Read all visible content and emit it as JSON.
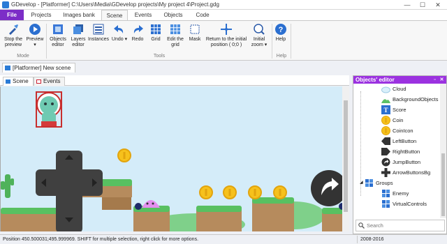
{
  "window": {
    "title": "GDevelop - [Platformer] C:\\Users\\Media\\GDevelop projects\\My project 4\\Project.gdg",
    "minimize_glyph": "—",
    "maximize_glyph": "☐",
    "close_glyph": "✕"
  },
  "ribbon_tabs": [
    "File",
    "Projects",
    "Images bank",
    "Scene",
    "Events",
    "Objects",
    "Code"
  ],
  "ribbon": {
    "stop_preview": "Stop the preview",
    "preview": "Preview",
    "objects_editor": "Objects editor",
    "layers_editor": "Layers editor",
    "instances": "Instances",
    "undo": "Undo",
    "redo": "Redo",
    "grid": "Grid",
    "edit_grid": "Edit the grid",
    "mask": "Mask",
    "return_origin": "Return to the initial position ( 0;0 )",
    "initial_zoom": "Initial zoom",
    "help": "Help",
    "group_mode": "Mode",
    "group_tools": "Tools",
    "group_help": "Help",
    "accent": "#7c2dc7"
  },
  "document_tab": "[Platformer] New scene",
  "scene_tabs": [
    "Scene",
    "Events"
  ],
  "objects_panel": {
    "title": "Objects' editor",
    "accent": "#9b32e0",
    "items": [
      {
        "label": "Cloud",
        "icon": "cloud-icon"
      },
      {
        "label": "BackgroundObjects",
        "icon": "hill-icon"
      },
      {
        "label": "Score",
        "icon": "text-icon"
      },
      {
        "label": "Coin",
        "icon": "coin-icon"
      },
      {
        "label": "CoinIcon",
        "icon": "coin-icon"
      },
      {
        "label": "LeftButton",
        "icon": "left-arrow-icon"
      },
      {
        "label": "RightButton",
        "icon": "right-arrow-icon"
      },
      {
        "label": "JumpButton",
        "icon": "jump-button-icon"
      },
      {
        "label": "ArrowButtonsBg",
        "icon": "plus-shape-icon"
      }
    ],
    "groups_label": "Groups",
    "groups": [
      {
        "label": "Enemy",
        "icon": "group-icon"
      },
      {
        "label": "VirtualControls",
        "icon": "group-icon"
      }
    ],
    "search_placeholder": "Search"
  },
  "status": {
    "left": "Position 450.500031;495.999969. SHIFT for multiple selection, right click for more options.",
    "right": "2008-2016"
  }
}
